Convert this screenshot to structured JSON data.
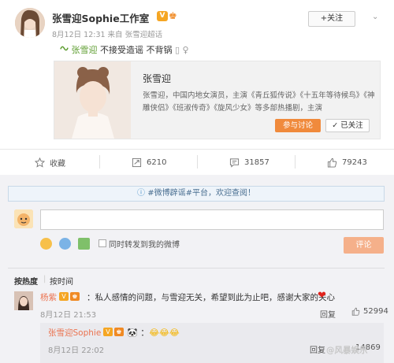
{
  "post": {
    "author": "张雪迎Sophie工作室",
    "meta": "8月12日 12:31 来自 张雪迎超话",
    "topic": "张雪迎",
    "content": "不接受造谣 不背锅",
    "follow_label": "+关注"
  },
  "card": {
    "name": "张雪迎",
    "description": "张雪迎，中国内地女演员，主演《青丘狐传说》《十五年等待候鸟》《神雕侠侣》《班淑传奇》《旋风少女》等多部热播剧，主演",
    "join_label": "参与讨论",
    "followed_label": "已关注"
  },
  "actions": {
    "favorite_label": "收藏",
    "repost_count": "6210",
    "comment_count": "31857",
    "like_count": "79243"
  },
  "comment_box": {
    "notice": "#微博辟谣#平台，欢迎查阅！",
    "repost_label": "同时转发到我的微博",
    "submit_label": "评论"
  },
  "sort": {
    "by_hot": "按热度",
    "by_time": "按时间"
  },
  "comment": {
    "user": "杨紫",
    "text": "：私人感情的问题，与雪迎无关，希望到此为止吧，感谢大家的关心",
    "time": "8月12日 21:53",
    "reply_label": "回复",
    "like_count": "52994"
  },
  "sub_reply": {
    "user": "张雪迎Sophie",
    "time": "8月12日 22:02",
    "reply_label": "回复",
    "like_count": "14869"
  },
  "watermark": "@风暴娱乐",
  "colors": {
    "accent_orange": "#f08a3c",
    "username_orange": "#eb7350",
    "topic_green": "#5c9c2e"
  }
}
